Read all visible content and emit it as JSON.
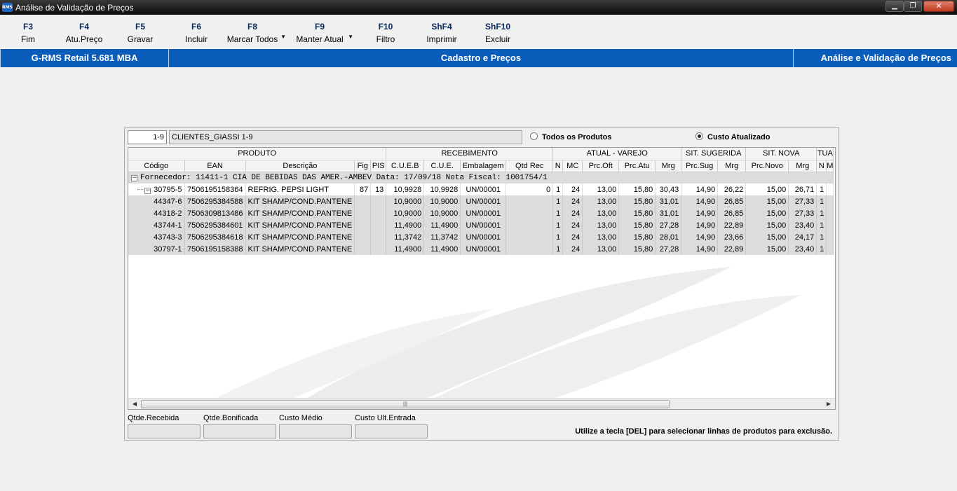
{
  "window": {
    "icon_text": "RMS",
    "title": "Análise de Validação de Preços",
    "min_glyph": "▁",
    "max_glyph": "❐",
    "close_glyph": "✕"
  },
  "toolbar": [
    {
      "key": "F3",
      "label": "Fim"
    },
    {
      "key": "F4",
      "label": "Atu.Preço"
    },
    {
      "key": "F5",
      "label": "Gravar"
    },
    {
      "key": "F6",
      "label": "Incluir"
    },
    {
      "key": "F8",
      "label": "Marcar Todos",
      "dropdown": true
    },
    {
      "key": "F9",
      "label": "Manter Atual",
      "dropdown": true
    },
    {
      "key": "F10",
      "label": "Filtro"
    },
    {
      "key": "ShF4",
      "label": "Imprimir"
    },
    {
      "key": "ShF10",
      "label": "Excluir"
    }
  ],
  "dropdown_glyph": "▼",
  "infobar": {
    "product": "G-RMS Retail 5.681 MBA",
    "module": "Cadastro e Preços",
    "screen": "Análise e Validação de Preços"
  },
  "filter": {
    "store_code": "1-9",
    "store_name": "CLIENTES_GIASSI 1-9",
    "radio_all": "Todos os Produtos",
    "radio_updated": "Custo Atualizado",
    "selected": "Custo Atualizado"
  },
  "grid": {
    "groups": [
      "PRODUTO",
      "RECEBIMENTO",
      "ATUAL - VAREJO",
      "SIT. SUGERIDA",
      "SIT. NOVA",
      "TUA"
    ],
    "columns": [
      "Código",
      "EAN",
      "Descrição",
      "Fig",
      "PIS",
      "C.U.E.B",
      "C.U.E.",
      "Embalagem",
      "Qtd Rec",
      "N",
      "MC",
      "Prc.Oft",
      "Prc.Atu",
      "Mrg",
      "Prc.Sug",
      "Mrg",
      "Prc.Novo",
      "Mrg",
      "N",
      "M"
    ],
    "supplier_row": "Fornecedor:  11411-1 CIA DE BEBIDAS DAS AMER.-AMBEV Data: 17/09/18 Nota Fiscal: 1001754/1",
    "collapse_glyph": "−",
    "rows": [
      [
        "30795-5",
        "7506195158364",
        "REFRIG. PEPSI LIGHT",
        "87",
        "13",
        "10,9928",
        "10,9928",
        "UN/00001",
        "0",
        "1",
        "24",
        "13,00",
        "15,80",
        "30,43",
        "14,90",
        "26,22",
        "15,00",
        "26,71",
        "1",
        ""
      ],
      [
        "44347-6",
        "7506295384588",
        "KIT SHAMP/COND.PANTENE",
        "",
        "",
        "10,9000",
        "10,9000",
        "UN/00001",
        "",
        "1",
        "24",
        "13,00",
        "15,80",
        "31,01",
        "14,90",
        "26,85",
        "15,00",
        "27,33",
        "1",
        ""
      ],
      [
        "44318-2",
        "7506309813486",
        "KIT SHAMP/COND.PANTENE",
        "",
        "",
        "10,9000",
        "10,9000",
        "UN/00001",
        "",
        "1",
        "24",
        "13,00",
        "15,80",
        "31,01",
        "14,90",
        "26,85",
        "15,00",
        "27,33",
        "1",
        ""
      ],
      [
        "43744-1",
        "7506295384601",
        "KIT SHAMP/COND.PANTENE",
        "",
        "",
        "11,4900",
        "11,4900",
        "UN/00001",
        "",
        "1",
        "24",
        "13,00",
        "15,80",
        "27,28",
        "14,90",
        "22,89",
        "15,00",
        "23,40",
        "1",
        ""
      ],
      [
        "43743-3",
        "7506295384618",
        "KIT SHAMP/COND.PANTENE",
        "",
        "",
        "11,3742",
        "11,3742",
        "UN/00001",
        "",
        "1",
        "24",
        "13,00",
        "15,80",
        "28,01",
        "14,90",
        "23,66",
        "15,00",
        "24,17",
        "1",
        ""
      ],
      [
        "30797-1",
        "7506195158388",
        "KIT SHAMP/COND.PANTENE",
        "",
        "",
        "11,4900",
        "11,4900",
        "UN/00001",
        "",
        "1",
        "24",
        "13,00",
        "15,80",
        "27,28",
        "14,90",
        "22,89",
        "15,00",
        "23,40",
        "1",
        ""
      ]
    ],
    "scroll_left": "◀",
    "scroll_right": "▶",
    "scroll_grip": "|||"
  },
  "footer": {
    "labels": [
      "Qtde.Recebida",
      "Qtde.Bonificada",
      "Custo Médio",
      "Custo Ult.Entrada"
    ],
    "hint": "Utilize a tecla [DEL] para selecionar linhas de produtos para exclusão."
  }
}
